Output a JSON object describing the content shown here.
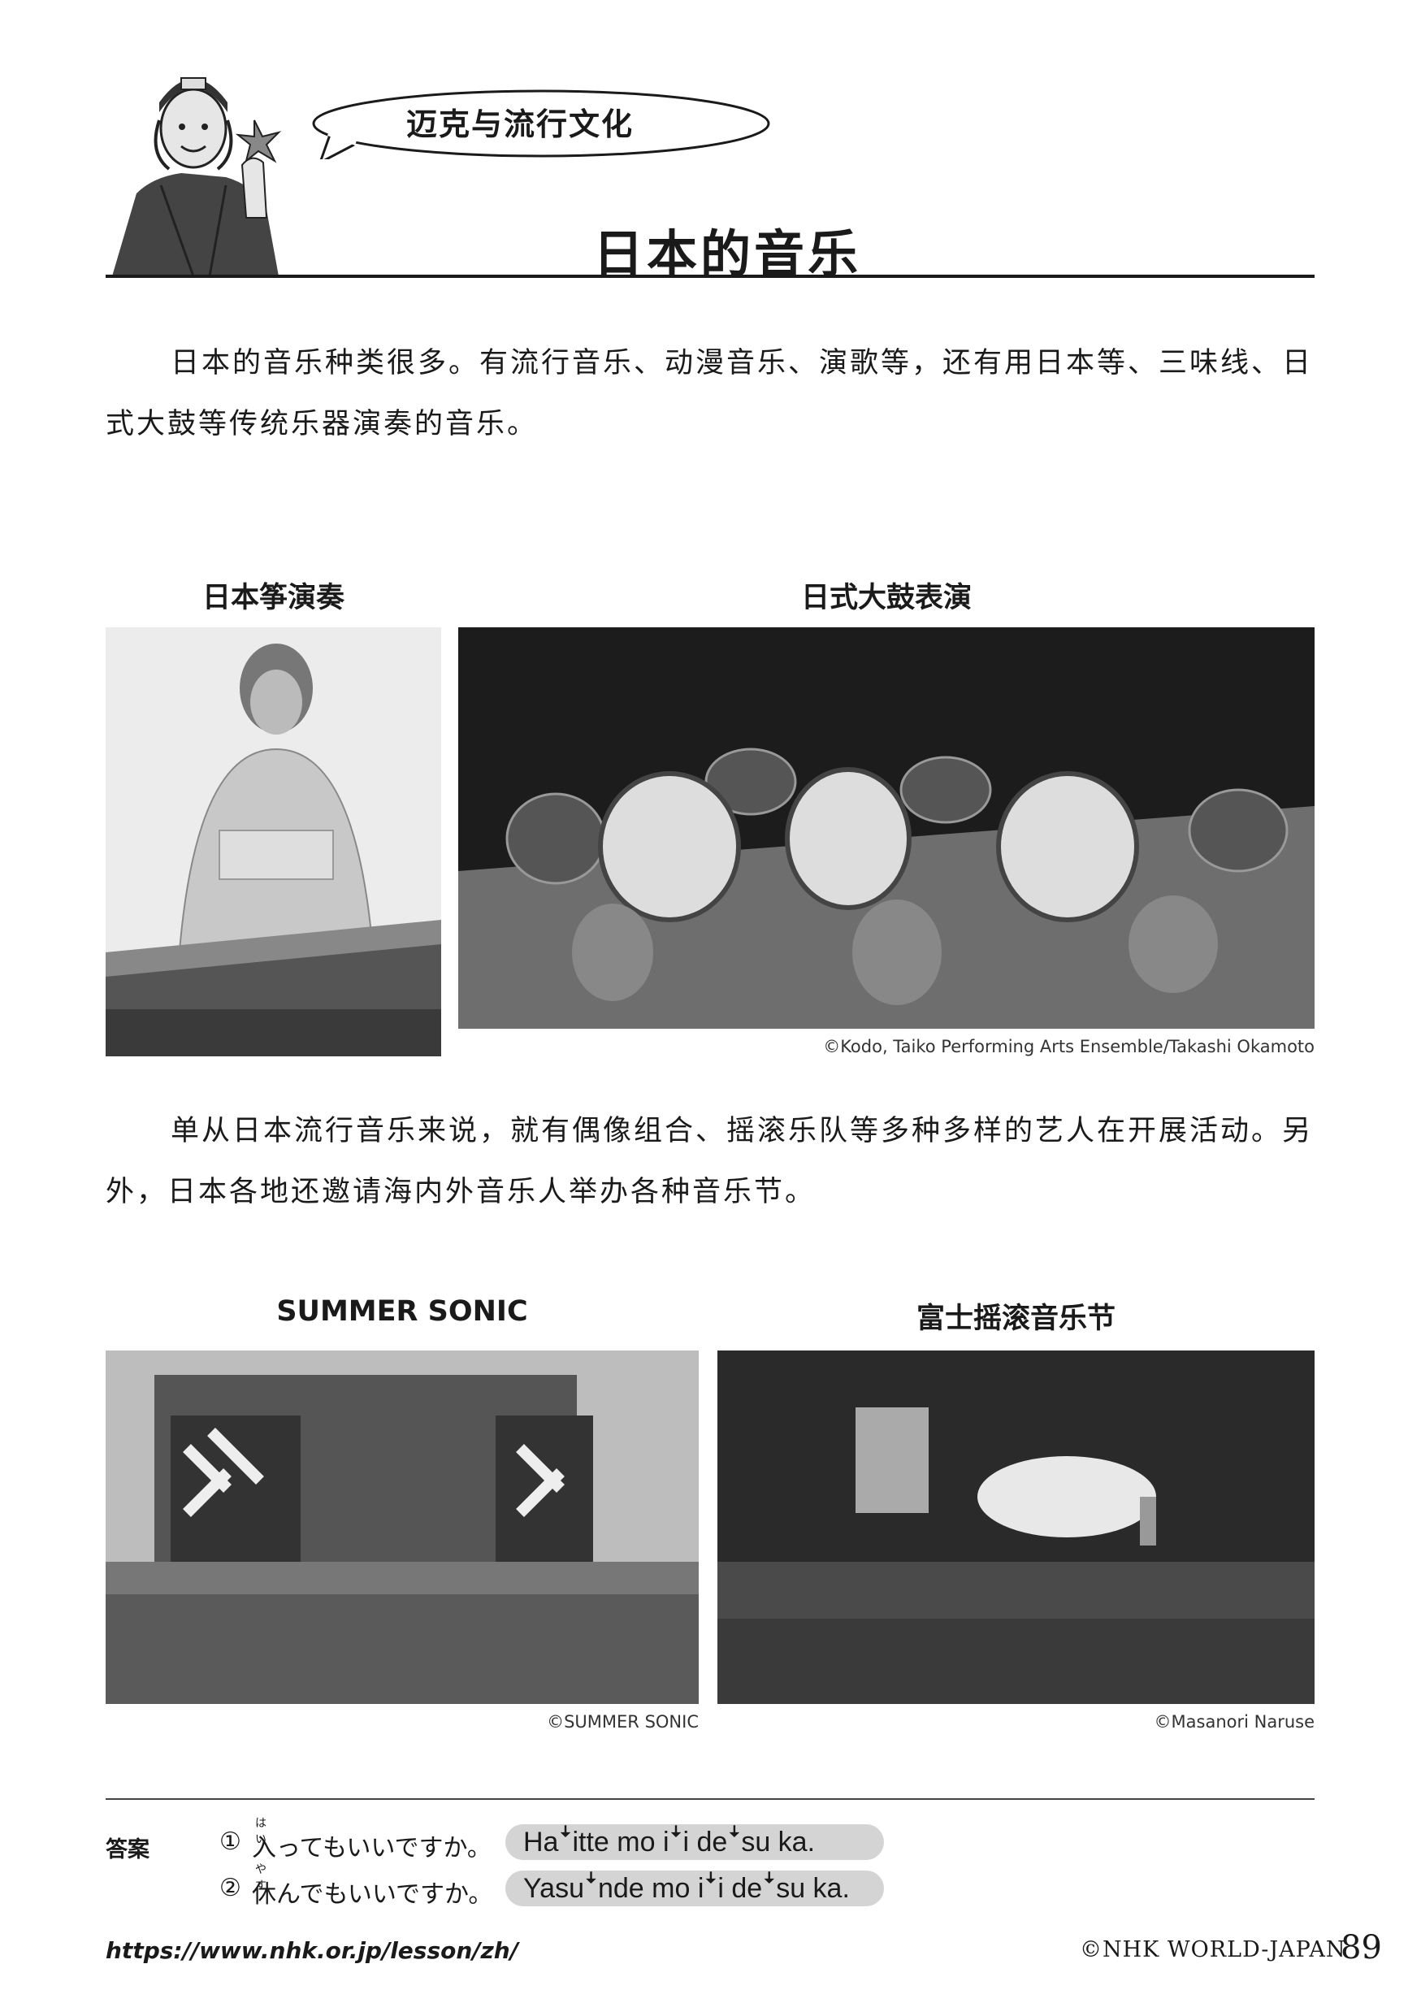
{
  "header": {
    "bubble_text": "迈克与流行文化",
    "title": "日本的音乐"
  },
  "intro_paragraph": "日本的音乐种类很多。有流行音乐、动漫音乐、演歌等，还有用日本等、三味线、日式大鼓等传统乐器演奏的音乐。",
  "photos_traditional": {
    "koto_caption": "日本筝演奏",
    "taiko_caption": "日式大鼓表演",
    "taiko_credit": "©Kodo, Taiko Performing Arts Ensemble/Takashi Okamoto"
  },
  "pop_paragraph": "单从日本流行音乐来说，就有偶像组合、摇滚乐队等多种多样的艺人在开展活动。另外，日本各地还邀请海内外音乐人举办各种音乐节。",
  "photos_festivals": {
    "summer_caption": "SUMMER SONIC",
    "summer_credit": "©SUMMER SONIC",
    "fuji_caption": "富士摇滚音乐节",
    "fuji_credit": "©Masanori Naruse"
  },
  "answers": {
    "label": "答案",
    "items": [
      {
        "num": "①",
        "ruby": "はい",
        "jp": "入ってもいいですか。",
        "romaji": "Haꜜitte mo iꜜi deꜜsu ka."
      },
      {
        "num": "②",
        "ruby": "やす",
        "jp": "休んでもいいですか。",
        "romaji": "Yasuꜜnde mo iꜜi deꜜsu ka."
      }
    ]
  },
  "footer": {
    "url": "https://www.nhk.or.jp/lesson/zh/",
    "copyright": "©NHK WORLD-JAPAN",
    "page_number": "89"
  }
}
